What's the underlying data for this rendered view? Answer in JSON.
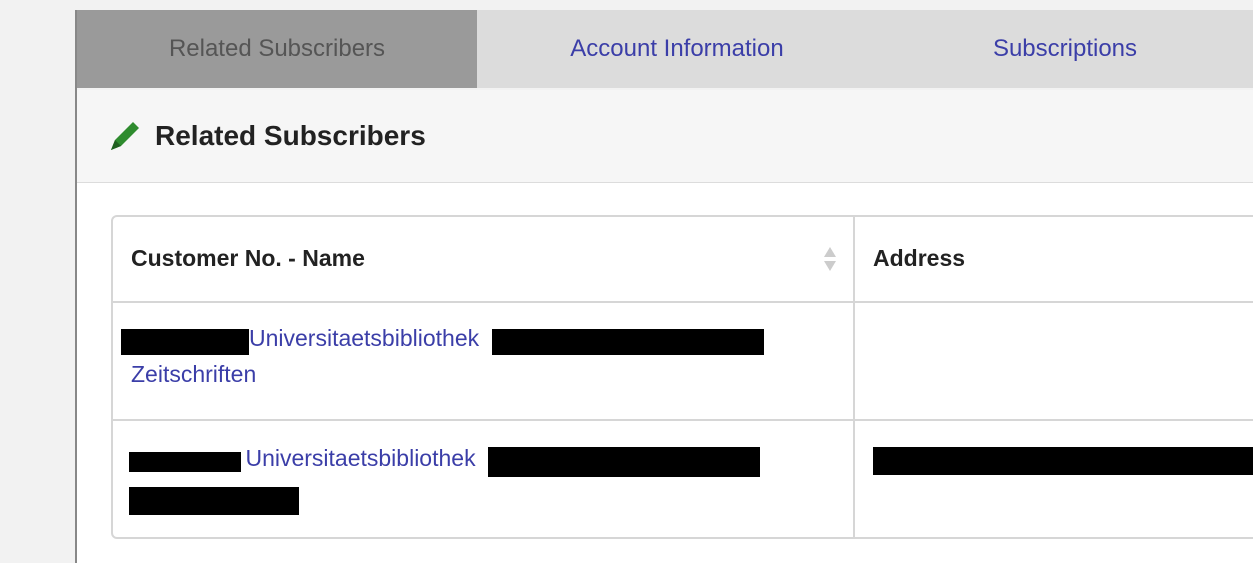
{
  "tabs": [
    {
      "label": "Related Subscribers",
      "active": true
    },
    {
      "label": "Account Information",
      "active": false
    },
    {
      "label": "Subscriptions",
      "active": false
    }
  ],
  "panel": {
    "title": "Related Subscribers",
    "icon": "pencil-icon"
  },
  "table": {
    "columns": [
      "Customer No. - Name",
      "Address"
    ],
    "rows": [
      {
        "name_part1": "Universitaetsbibliothek",
        "name_part2": "Zeitschriften",
        "address": ""
      },
      {
        "name_part1": "Universitaetsbibliothek",
        "name_part2": "",
        "address": ""
      }
    ]
  },
  "colors": {
    "link": "#3b3ea8",
    "active_tab": "#9a9a9a",
    "inactive_tab": "#dcdcdc",
    "pencil": "#2e8b2e"
  }
}
